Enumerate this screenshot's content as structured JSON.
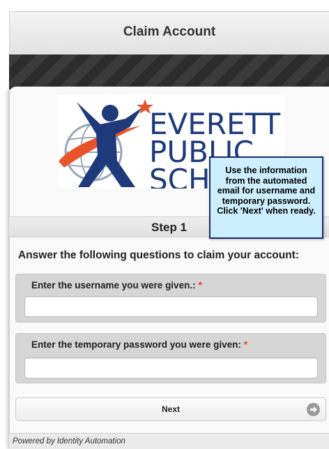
{
  "header": {
    "title": "Claim Account"
  },
  "logo": {
    "line1": "EVERETT",
    "line2": "PUBLIC",
    "line3": "SCHO",
    "icon": "everett-logo-figure-icon",
    "colors": {
      "figure": "#1e3a7b",
      "text": "#1e3a7b",
      "star": "#e8542a",
      "swoosh": "#e8542a",
      "globe": "#9aa6b6"
    }
  },
  "tooltip": {
    "text": "Use the information from the automated email for username and temporary password. Click 'Next' when ready."
  },
  "step": {
    "label": "Step 1"
  },
  "form": {
    "instructions": "Answer the following questions to claim your account:",
    "username": {
      "label": "Enter the username you were given.:",
      "required_marker": "*",
      "value": ""
    },
    "password": {
      "label": "Enter the temporary password you were given:",
      "required_marker": "*",
      "value": ""
    }
  },
  "actions": {
    "next_label": "Next",
    "next_icon": "arrow-right-circle-icon"
  },
  "footer": {
    "text": "Powered by Identity Automation"
  },
  "theme": {
    "required": "#e0393c",
    "tooltip_bg": "#cdeefe",
    "tooltip_border": "#1a2a6c",
    "header_stripes": "#3a3a3a"
  }
}
